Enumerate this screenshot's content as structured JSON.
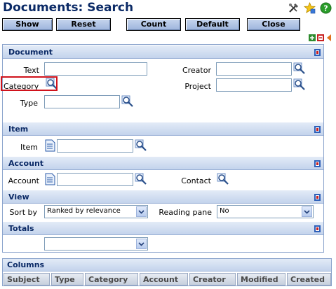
{
  "title": "Documents: Search",
  "toolbar": {
    "show": "Show",
    "reset": "Reset",
    "count": "Count",
    "default": "Default",
    "close": "Close"
  },
  "sections": {
    "document": "Document",
    "item": "Item",
    "account": "Account",
    "view": "View",
    "totals": "Totals"
  },
  "fields": {
    "text_label": "Text",
    "creator_label": "Creator",
    "category_label": "Category",
    "project_label": "Project",
    "type_label": "Type",
    "item_label": "Item",
    "account_label": "Account",
    "contact_label": "Contact",
    "sortby_label": "Sort by",
    "sortby_value": "Ranked by relevance",
    "readingpane_label": "Reading pane",
    "readingpane_value": "No",
    "totals_value": ""
  },
  "columns": {
    "header": "Columns",
    "items": [
      "Subject",
      "Type",
      "Category",
      "Account",
      "Creator",
      "Modified",
      "Created"
    ]
  },
  "colors": {
    "title": "#0b2a66",
    "section_bg": "#c3d3ec",
    "highlight": "#d0121b"
  }
}
